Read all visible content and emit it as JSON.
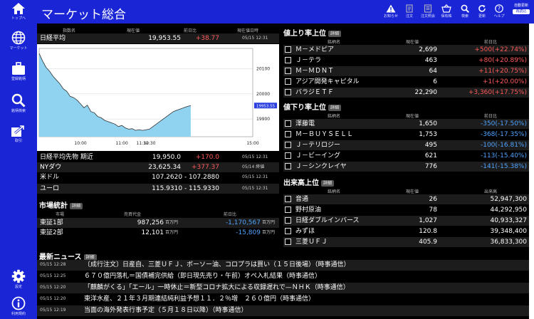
{
  "sidebar": {
    "top": "トップへ",
    "market": "マーケット",
    "register": "登録銘柄",
    "search": "銘柄検索",
    "trade": "取引",
    "settings": "設定",
    "terms": "利用規約"
  },
  "topbar": {
    "title": "マーケット総合",
    "icons": {
      "notice": "お知らせ",
      "order": "注文",
      "orders": "注文照会",
      "portfolio": "保有株",
      "search": "検索",
      "refresh": "更新",
      "help": "ヘルプ"
    },
    "auto_update": "自動更新",
    "auto_update_state": "再読込"
  },
  "index": {
    "headers": {
      "name": "指数名",
      "price": "現在値",
      "change": "前日比",
      "time": "現在値日時"
    },
    "rows": [
      {
        "name": "日経平均",
        "price": "19,953.55",
        "change": "+38.77",
        "time": "05/15 12:31"
      },
      {
        "name": "日経平均先物 期近",
        "price": "19,950.0",
        "change": "+170.0",
        "time": "05/15 12:31"
      },
      {
        "name": "NYダウ",
        "price": "23,625.34",
        "change": "+377.37",
        "time": "05/14 終値"
      },
      {
        "name": "米ドル",
        "price": "107.2620 - 107.2880",
        "change": "",
        "time": "05/15 12:31"
      },
      {
        "name": "ユーロ",
        "price": "115.9310 - 115.9330",
        "change": "",
        "time": "05/15 12:31"
      }
    ]
  },
  "chart_data": {
    "type": "area",
    "x_labels": [
      "10:00",
      "11:00",
      "11:30",
      "12:30",
      "15:00"
    ],
    "y_ticks": [
      19900,
      20000,
      20100
    ],
    "ylim": [
      19830,
      20180
    ],
    "current": "19953.55",
    "x": [
      "09:00",
      "09:05",
      "09:10",
      "09:15",
      "09:20",
      "09:25",
      "09:30",
      "09:35",
      "09:40",
      "09:45",
      "09:50",
      "09:55",
      "10:00",
      "10:05",
      "10:10",
      "10:15",
      "10:20",
      "10:25",
      "10:30",
      "10:35",
      "10:40",
      "10:45",
      "10:50",
      "10:55",
      "11:00",
      "11:05",
      "11:10",
      "11:15",
      "11:20",
      "11:25",
      "11:30",
      "12:30",
      "12:35",
      "12:40",
      "12:45",
      "12:50",
      "12:55",
      "13:00",
      "13:05",
      "13:10",
      "13:15",
      "13:20",
      "13:25",
      "13:30"
    ],
    "values": [
      20160,
      20130,
      20105,
      20090,
      20070,
      20055,
      20040,
      20020,
      20010,
      19990,
      19985,
      19975,
      19960,
      19945,
      19955,
      19930,
      19925,
      19910,
      19905,
      19895,
      19890,
      19885,
      19880,
      19870,
      19875,
      19865,
      19860,
      19862,
      19855,
      19858,
      19855,
      19860,
      19870,
      19880,
      19890,
      19900,
      19910,
      19920,
      19930,
      19935,
      19940,
      19945,
      19950,
      19953.55
    ]
  },
  "market_stats": {
    "title": "市場統計",
    "detail": "詳細",
    "headers": {
      "market": "市場",
      "amount": "売買代金",
      "change": "前日比"
    },
    "unit": "百万円",
    "rows": [
      {
        "market": "東証1部",
        "amount": "987,256",
        "change": "-1,170,567"
      },
      {
        "market": "東証2部",
        "amount": "12,101",
        "change": "-15,809"
      }
    ]
  },
  "news": {
    "title": "最新ニュース",
    "detail": "詳細",
    "items": [
      {
        "time": "05/15 12:28",
        "text": "〔成行注文〕日産自、三菱ＵＦＪ、ボーソー油、コロプラは買い（１５日後場）（時事通信）"
      },
      {
        "time": "05/15 12:25",
        "text": "６７０億円落札＝国債補完供給（即日現先売り・午前）オペ入札結果（時事通信）"
      },
      {
        "time": "05/15 12:20",
        "text": "「麒麟がくる」「エール」一時休止＝新型コロナ拡大による収録遅れで—ＮＨＫ（時事通信）"
      },
      {
        "time": "05/15 12:20",
        "text": "東洋水産、２１年３月期連結純利益予想１１．２％増　２６０億円（時事通信）"
      },
      {
        "time": "05/15 12:19",
        "text": "当面の海外発表行事予定（５月１８日以降）（時事通信）"
      }
    ]
  },
  "gainers": {
    "title": "値上り率上位",
    "detail": "詳細",
    "headers": {
      "name": "銘柄名",
      "price": "現在値",
      "change": "前日比"
    },
    "rows": [
      {
        "name": "Ｍ－メドピア",
        "price": "2,699",
        "change": "+500(+22.74%)"
      },
      {
        "name": "Ｊ－テラ",
        "price": "463",
        "change": "+80(+20.89%)"
      },
      {
        "name": "Ｍ－ＭＤＮＴ",
        "price": "64",
        "change": "+11(+20.75%)"
      },
      {
        "name": "アジア開発キャピタル",
        "price": "6",
        "change": "+1(+20.00%)"
      },
      {
        "name": "バラジＥＴＦ",
        "price": "22,290",
        "change": "+3,360(+17.75%)"
      }
    ]
  },
  "losers": {
    "title": "値下り率上位",
    "detail": "詳細",
    "headers": {
      "name": "銘柄名",
      "price": "現在値",
      "change": "前日比"
    },
    "rows": [
      {
        "name": "澤藤電",
        "price": "1,650",
        "change": "-350(-17.50%)"
      },
      {
        "name": "Ｍ－ＢＵＹＳＥＬＬ",
        "price": "1,753",
        "change": "-368(-17.35%)"
      },
      {
        "name": "Ｊ－テリロジー",
        "price": "495",
        "change": "-100(-16.81%)"
      },
      {
        "name": "Ｊ－ビーイング",
        "price": "621",
        "change": "-113(-15.40%)"
      },
      {
        "name": "Ｊ－シンクレイヤ",
        "price": "776",
        "change": "-141(-15.38%)"
      }
    ]
  },
  "volume": {
    "title": "出来高上位",
    "detail": "詳細",
    "headers": {
      "name": "銘柄名",
      "price": "現在値",
      "volume": "出来高"
    },
    "rows": [
      {
        "name": "音通",
        "price": "26",
        "volume": "52,947,300"
      },
      {
        "name": "野村原油",
        "price": "78",
        "volume": "44,292,950"
      },
      {
        "name": "日経ダブルインバース",
        "price": "1,027",
        "volume": "40,933,327"
      },
      {
        "name": "みずほ",
        "price": "120.8",
        "volume": "39,348,400"
      },
      {
        "name": "三菱ＵＦＪ",
        "price": "405.9",
        "volume": "36,833,300"
      }
    ]
  }
}
